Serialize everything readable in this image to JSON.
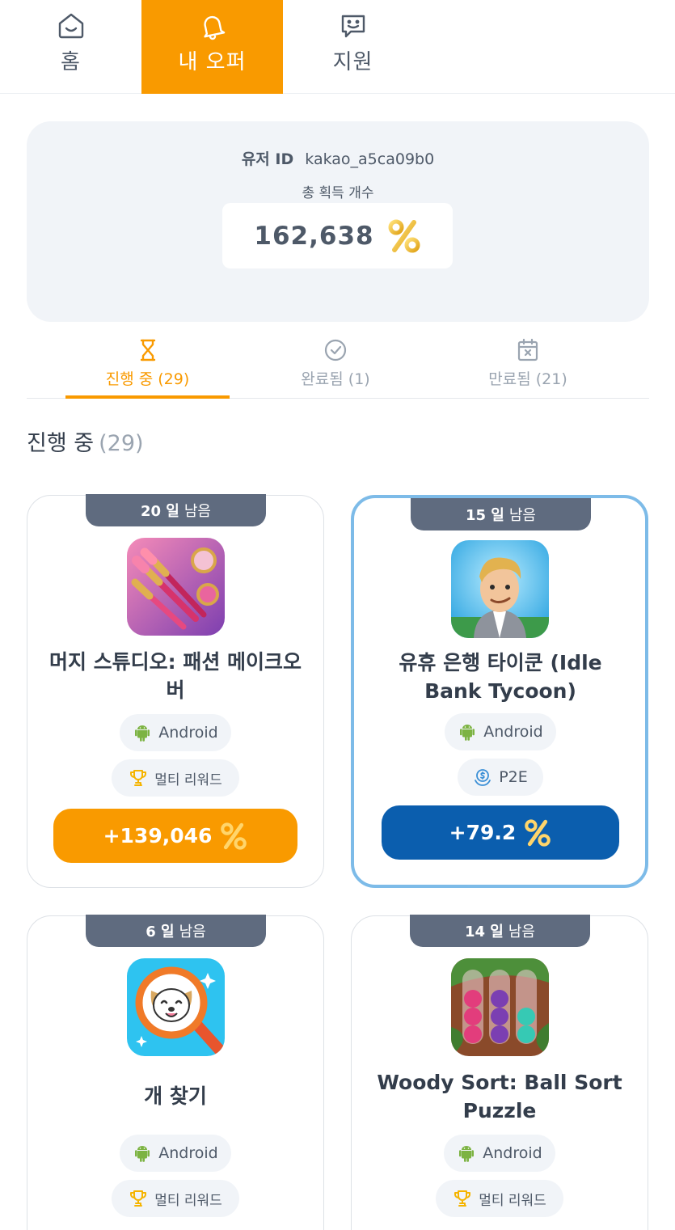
{
  "nav": {
    "home": "홈",
    "my_offers": "내 오퍼",
    "support": "지원",
    "active_color": "#f99a00"
  },
  "summary": {
    "user_id_label": "유저 ID",
    "user_id": "kakao_a5ca09b0",
    "total_label": "총 획득 개수",
    "total_value": "162,638"
  },
  "tabs": [
    {
      "label": "진행 중 (29)",
      "icon": "hourglass-icon"
    },
    {
      "label": "완료됨 (1)",
      "icon": "check-circle-icon"
    },
    {
      "label": "만료됨 (21)",
      "icon": "calendar-x-icon"
    }
  ],
  "section": {
    "title": "진행 중",
    "count": "(29)"
  },
  "days_suffix": "남음",
  "offers": [
    {
      "days": "20 일",
      "title": "머지 스튜디오: 패션 메이크오버",
      "platform": "Android",
      "tag": "멀티 리워드",
      "reward": "+139,046",
      "button_color": "#f99a00"
    },
    {
      "days": "15 일",
      "title": "유휴 은행 타이쿤 (Idle Bank Tycoon)",
      "platform": "Android",
      "tag": "P2E",
      "reward": "+79.2",
      "button_color": "#0b5eae"
    },
    {
      "days": "6 일",
      "title": "개 찾기",
      "platform": "Android",
      "tag": "멀티 리워드"
    },
    {
      "days": "14 일",
      "title": "Woody Sort: Ball Sort Puzzle",
      "platform": "Android",
      "tag": "멀티 리워드"
    }
  ]
}
